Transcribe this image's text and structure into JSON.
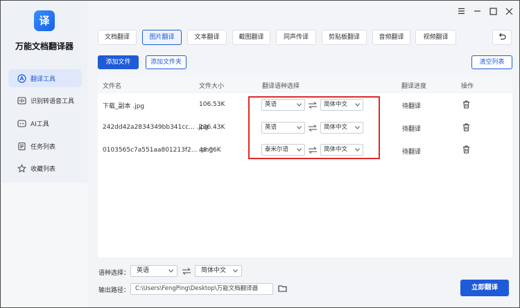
{
  "app": {
    "logo_char": "译",
    "title": "万能文档翻译器"
  },
  "sidebar": {
    "items": [
      {
        "label": "翻译工具",
        "icon": "translate-icon",
        "active": true
      },
      {
        "label": "识别转语音工具",
        "icon": "voice-icon",
        "active": false
      },
      {
        "label": "AI工具",
        "icon": "ai-icon",
        "active": false
      },
      {
        "label": "任务列表",
        "icon": "task-list-icon",
        "active": false
      },
      {
        "label": "收藏列表",
        "icon": "star-icon",
        "active": false
      }
    ]
  },
  "tabs": [
    {
      "label": "文档翻译"
    },
    {
      "label": "图片翻译",
      "active": true
    },
    {
      "label": "文本翻译"
    },
    {
      "label": "截图翻译"
    },
    {
      "label": "同声传译"
    },
    {
      "label": "剪贴板翻译"
    },
    {
      "label": "音频翻译"
    },
    {
      "label": "视频翻译"
    }
  ],
  "toolbar": {
    "add_file": "添加文件",
    "add_folder": "添加文件夹",
    "clear_list": "清空列表"
  },
  "table": {
    "headers": {
      "name": "文件名",
      "size": "文件大小",
      "lang": "翻译语种选择",
      "progress": "翻译进度",
      "action": "操作"
    },
    "rows": [
      {
        "name": "下载_副本 .jpg",
        "size": "106.53K",
        "source": "英语",
        "target": "简体中文",
        "status": "待翻译"
      },
      {
        "name": "242dd42a2834349bb341cc... .jpg",
        "size": "236.43K",
        "source": "英语",
        "target": "简体中文",
        "status": "待翻译"
      },
      {
        "name": "0103565c7a551aa801213f2... .png",
        "size": "48.06K",
        "source": "泰米尔语",
        "target": "简体中文",
        "status": "待翻译"
      }
    ]
  },
  "bottom": {
    "lang_label": "语种选择：",
    "source": "英语",
    "target": "简体中文",
    "output_label": "输出路径：",
    "output_path": "C:\\Users\\FengPing\\Desktop\\万能文档翻译器",
    "translate_button": "立即翻译"
  },
  "colors": {
    "accent": "#1f5bd8",
    "highlight": "#e02828"
  }
}
